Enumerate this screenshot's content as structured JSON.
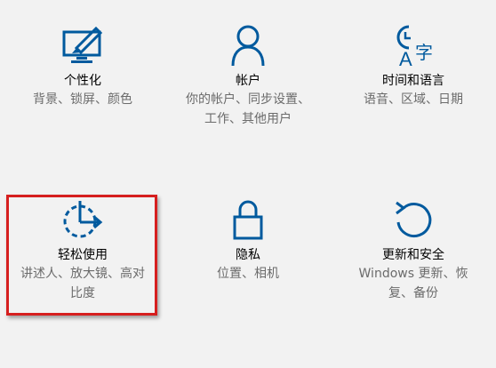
{
  "tiles": [
    {
      "title": "个性化",
      "desc_lines": [
        "背景、锁屏、颜色"
      ],
      "icon": "personalization-icon"
    },
    {
      "title": "帐户",
      "desc_lines": [
        "你的帐户、同步设置、",
        "工作、其他用户"
      ],
      "icon": "account-icon"
    },
    {
      "title": "时间和语言",
      "desc_lines": [
        "语音、区域、日期"
      ],
      "icon": "time-language-icon"
    },
    {
      "title": "轻松使用",
      "desc_lines": [
        "讲述人、放大镜、高对",
        "比度"
      ],
      "icon": "ease-of-access-icon"
    },
    {
      "title": "隐私",
      "desc_lines": [
        "位置、相机"
      ],
      "icon": "lock-icon"
    },
    {
      "title": "更新和安全",
      "desc_lines": [
        "Windows 更新、恢",
        "复、备份"
      ],
      "icon": "update-icon"
    }
  ],
  "colors": {
    "accent": "#005a9e",
    "highlight": "#d61f1f",
    "desc": "#6b6b6b"
  }
}
